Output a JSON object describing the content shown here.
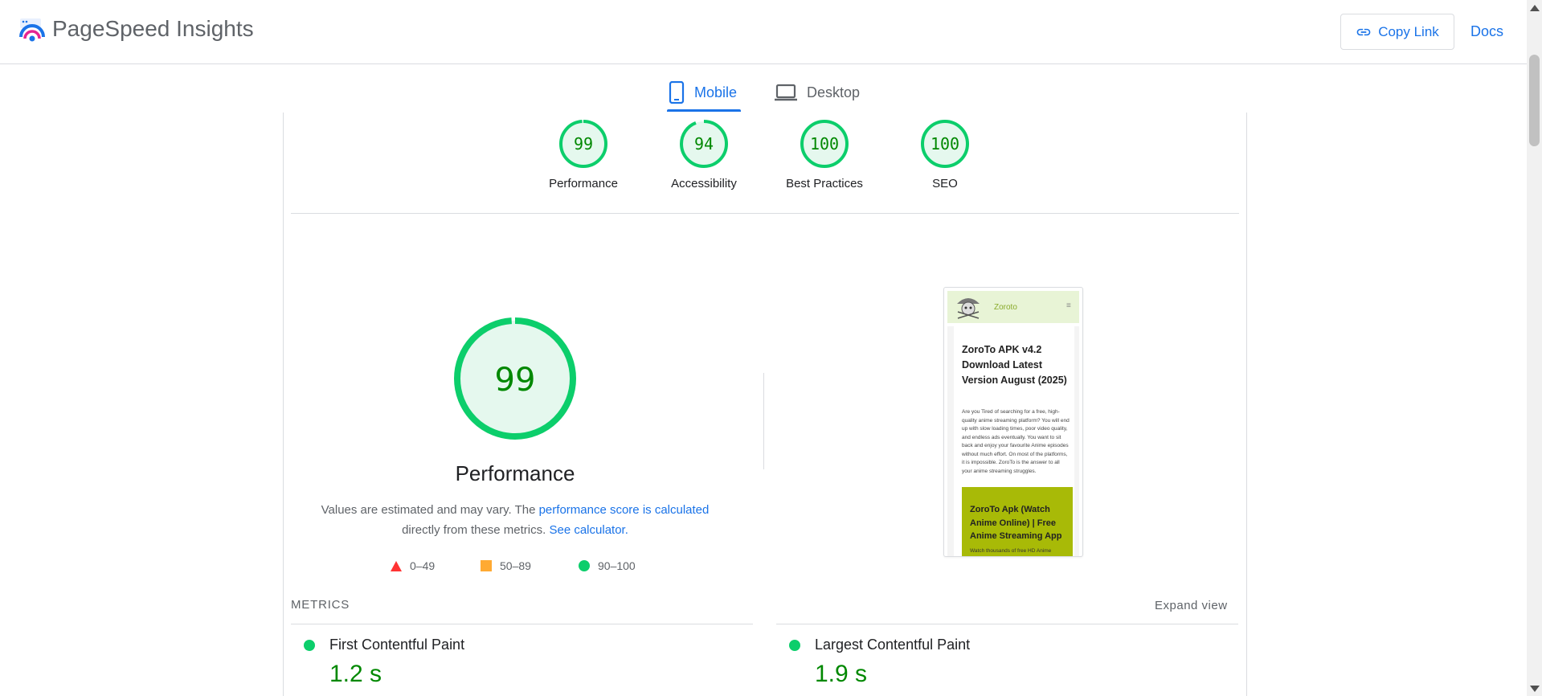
{
  "header": {
    "brand": "PageSpeed Insights",
    "copy_link_label": "Copy Link",
    "docs_label": "Docs"
  },
  "tabs": [
    {
      "label": "Mobile",
      "active": true
    },
    {
      "label": "Desktop",
      "active": false
    }
  ],
  "categories": [
    {
      "label": "Performance",
      "score": 99
    },
    {
      "label": "Accessibility",
      "score": 94
    },
    {
      "label": "Best Practices",
      "score": 100
    },
    {
      "label": "SEO",
      "score": 100
    }
  ],
  "performance": {
    "score": 99,
    "title": "Performance",
    "desc_prefix": "Values are estimated and may vary. The ",
    "desc_link": "performance score is calculated",
    "desc_middle": "directly from these metrics.",
    "desc_link2": "See calculator."
  },
  "legend": [
    {
      "label": "0–49",
      "shape": "triangle",
      "color": "#ff3333"
    },
    {
      "label": "50–89",
      "shape": "square",
      "color": "#ffaa33"
    },
    {
      "label": "90–100",
      "shape": "circle",
      "color": "#0cce6b"
    }
  ],
  "screenshot": {
    "brand": "Zoroto",
    "menu_icon": "≡",
    "heading": "ZoroTo APK v4.2 Download Latest Version August (2025)",
    "paragraph": "Are you Tired of searching for a free, high-quality anime streaming platform? You will end up with slow loading times, poor video quality, and endless ads eventually. You want to sit back and enjoy your favourite Anime episodes without much effort. On most of the platforms, it is impossible. ZoroTo is the answer to all your anime streaming struggles.",
    "box_heading": "ZoroTo Apk (Watch Anime Online) | Free Anime Streaming App",
    "box_text": "Watch thousands of free HD Anime"
  },
  "metrics": {
    "heading": "METRICS",
    "expand_label": "Expand view",
    "items": [
      {
        "name": "First Contentful Paint",
        "value": "1.2 s"
      },
      {
        "name": "Largest Contentful Paint",
        "value": "1.9 s"
      }
    ]
  },
  "colors": {
    "accent": "#1a73e8",
    "pass": "#0cce6b",
    "pass_text": "#008800",
    "pass_fill": "#e5f8ee"
  }
}
